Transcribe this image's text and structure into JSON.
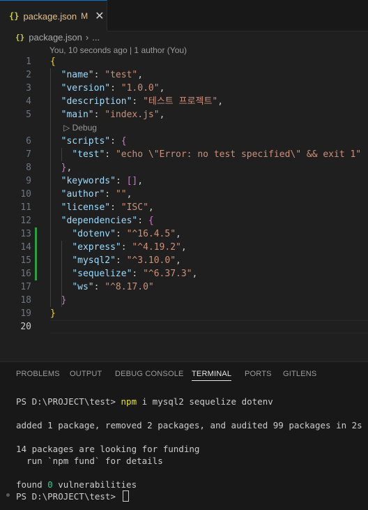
{
  "tab": {
    "icon": "{}",
    "label": "package.json",
    "modified": "M"
  },
  "breadcrumb": {
    "icon": "{}",
    "file": "package.json",
    "more": "..."
  },
  "blame": "You, 10 seconds ago | 1 author (You)",
  "codelens": "Debug",
  "lines": [
    {
      "n": "1",
      "parts": [
        [
          "b1",
          "{"
        ]
      ]
    },
    {
      "n": "2",
      "parts": [
        [
          "p",
          "  "
        ],
        [
          "k",
          "\"name\""
        ],
        [
          "p",
          ": "
        ],
        [
          "s",
          "\"test\""
        ],
        [
          "p",
          ","
        ]
      ]
    },
    {
      "n": "3",
      "parts": [
        [
          "p",
          "  "
        ],
        [
          "k",
          "\"version\""
        ],
        [
          "p",
          ": "
        ],
        [
          "s",
          "\"1.0.0\""
        ],
        [
          "p",
          ","
        ]
      ]
    },
    {
      "n": "4",
      "parts": [
        [
          "p",
          "  "
        ],
        [
          "k",
          "\"description\""
        ],
        [
          "p",
          ": "
        ],
        [
          "s",
          "\"테스트 프로젝트\""
        ],
        [
          "p",
          ","
        ]
      ]
    },
    {
      "n": "5",
      "parts": [
        [
          "p",
          "  "
        ],
        [
          "k",
          "\"main\""
        ],
        [
          "p",
          ": "
        ],
        [
          "s",
          "\"index.js\""
        ],
        [
          "p",
          ","
        ]
      ]
    },
    {
      "n": "6",
      "parts": [
        [
          "p",
          "  "
        ],
        [
          "k",
          "\"scripts\""
        ],
        [
          "p",
          ": "
        ],
        [
          "b2",
          "{"
        ]
      ]
    },
    {
      "n": "7",
      "parts": [
        [
          "p",
          "    "
        ],
        [
          "k",
          "\"test\""
        ],
        [
          "p",
          ": "
        ],
        [
          "s",
          "\"echo \\\"Error: no test specified\\\" && exit 1\""
        ]
      ]
    },
    {
      "n": "8",
      "parts": [
        [
          "p",
          "  "
        ],
        [
          "b2",
          "}"
        ],
        [
          "p",
          ","
        ]
      ]
    },
    {
      "n": "9",
      "parts": [
        [
          "p",
          "  "
        ],
        [
          "k",
          "\"keywords\""
        ],
        [
          "p",
          ": "
        ],
        [
          "b2",
          "[]"
        ],
        [
          "p",
          ","
        ]
      ]
    },
    {
      "n": "10",
      "parts": [
        [
          "p",
          "  "
        ],
        [
          "k",
          "\"author\""
        ],
        [
          "p",
          ": "
        ],
        [
          "s",
          "\"\""
        ],
        [
          "p",
          ","
        ]
      ]
    },
    {
      "n": "11",
      "parts": [
        [
          "p",
          "  "
        ],
        [
          "k",
          "\"license\""
        ],
        [
          "p",
          ": "
        ],
        [
          "s",
          "\"ISC\""
        ],
        [
          "p",
          ","
        ]
      ]
    },
    {
      "n": "12",
      "parts": [
        [
          "p",
          "  "
        ],
        [
          "k",
          "\"dependencies\""
        ],
        [
          "p",
          ": "
        ],
        [
          "b2",
          "{"
        ]
      ]
    },
    {
      "n": "13",
      "parts": [
        [
          "p",
          "    "
        ],
        [
          "k",
          "\"dotenv\""
        ],
        [
          "p",
          ": "
        ],
        [
          "s",
          "\"^16.4.5\""
        ],
        [
          "p",
          ","
        ]
      ]
    },
    {
      "n": "14",
      "parts": [
        [
          "p",
          "    "
        ],
        [
          "k",
          "\"express\""
        ],
        [
          "p",
          ": "
        ],
        [
          "s",
          "\"^4.19.2\""
        ],
        [
          "p",
          ","
        ]
      ]
    },
    {
      "n": "15",
      "parts": [
        [
          "p",
          "    "
        ],
        [
          "k",
          "\"mysql2\""
        ],
        [
          "p",
          ": "
        ],
        [
          "s",
          "\"^3.10.0\""
        ],
        [
          "p",
          ","
        ]
      ]
    },
    {
      "n": "16",
      "parts": [
        [
          "p",
          "    "
        ],
        [
          "k",
          "\"sequelize\""
        ],
        [
          "p",
          ": "
        ],
        [
          "s",
          "\"^6.37.3\""
        ],
        [
          "p",
          ","
        ]
      ]
    },
    {
      "n": "17",
      "parts": [
        [
          "p",
          "    "
        ],
        [
          "k",
          "\"ws\""
        ],
        [
          "p",
          ": "
        ],
        [
          "s",
          "\"^8.17.0\""
        ]
      ]
    },
    {
      "n": "18",
      "parts": [
        [
          "p",
          "  "
        ],
        [
          "b2",
          "}"
        ]
      ]
    },
    {
      "n": "19",
      "parts": [
        [
          "b1",
          "}"
        ]
      ]
    },
    {
      "n": "20",
      "parts": []
    }
  ],
  "panel_tabs": [
    "PROBLEMS",
    "OUTPUT",
    "DEBUG CONSOLE",
    "TERMINAL",
    "PORTS",
    "GITLENS"
  ],
  "active_panel_tab": "TERMINAL",
  "terminal": {
    "prompt": "PS D:\\PROJECT\\test> ",
    "cmd_word": "npm",
    "cmd_rest": " i mysql2 sequelize dotenv",
    "out1": "added 1 package, removed 2 packages, and audited 99 packages in 2s",
    "out2": "14 packages are looking for funding",
    "out3": "  run `npm fund` for details",
    "out4_pre": "found ",
    "out4_num": "0",
    "out4_post": " vulnerabilities",
    "prompt2": "PS D:\\PROJECT\\test> "
  },
  "colors": {
    "accent": "#0078d4",
    "git_added": "#2ea043",
    "key": "#9cdcfe",
    "string": "#ce9178"
  }
}
